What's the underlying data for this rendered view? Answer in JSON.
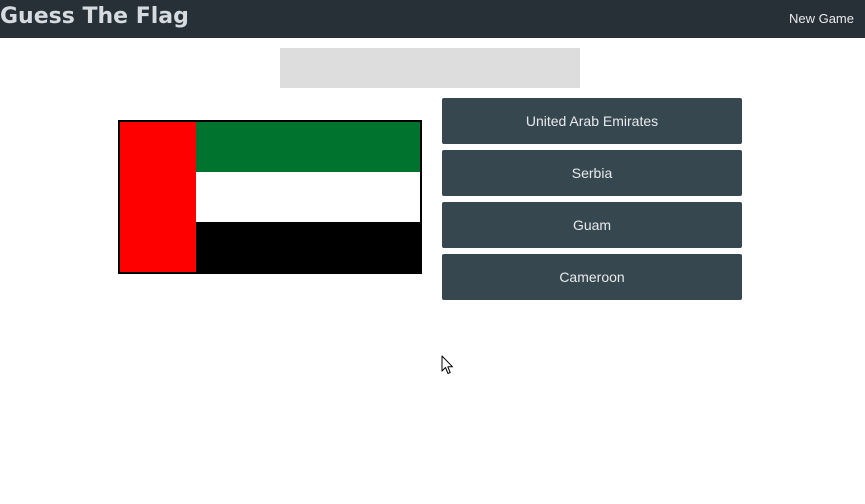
{
  "header": {
    "title": "Guess The Flag",
    "new_game_label": "New Game"
  },
  "status": {
    "message": ""
  },
  "flag": {
    "country": "United Arab Emirates",
    "colors": {
      "red": "#ff0000",
      "green": "#00732f",
      "white": "#ffffff",
      "black": "#000000"
    }
  },
  "choices": [
    {
      "label": "United Arab Emirates"
    },
    {
      "label": "Serbia"
    },
    {
      "label": "Guam"
    },
    {
      "label": "Cameroon"
    }
  ],
  "colors": {
    "navbar_bg": "#272f37",
    "button_bg": "#37474f",
    "status_bg": "#dddddd"
  }
}
